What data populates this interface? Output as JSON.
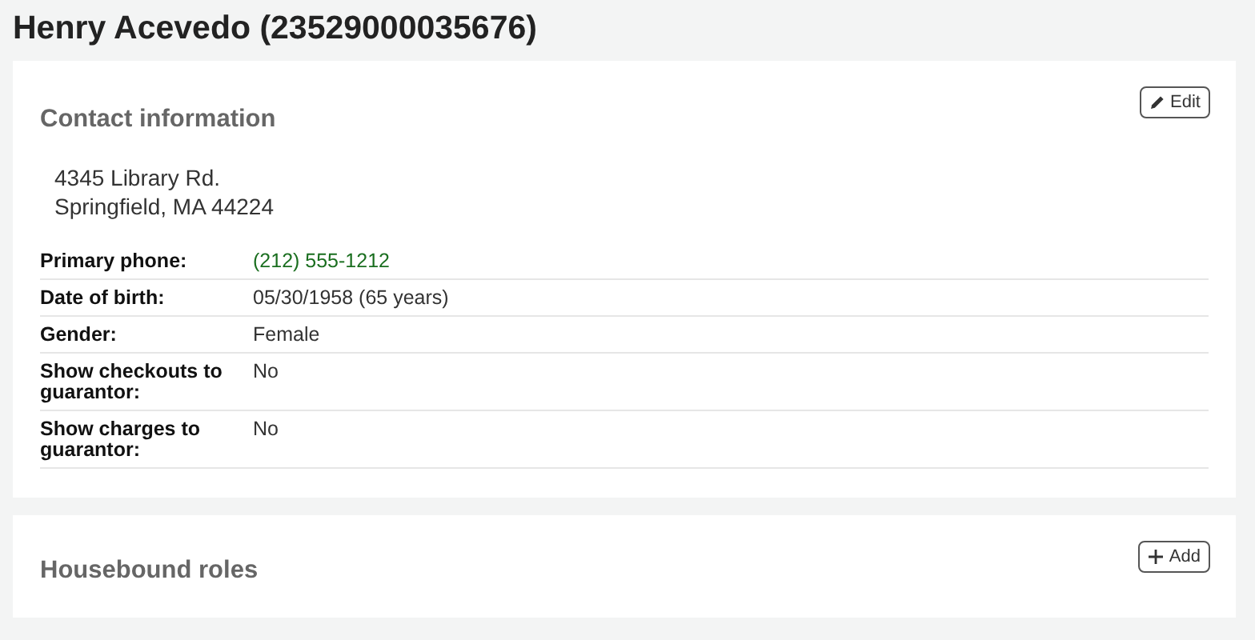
{
  "page_title": "Henry Acevedo (23529000035676)",
  "contact": {
    "heading": "Contact information",
    "edit_button": "Edit",
    "address": [
      "4345 Library Rd.",
      "Springfield, MA 44224"
    ],
    "fields": [
      {
        "label": "Primary phone:",
        "value": "(212) 555-1212",
        "kind": "link"
      },
      {
        "label": "Date of birth:",
        "value": "05/30/1958 (65 years)",
        "kind": "text"
      },
      {
        "label": "Gender:",
        "value": "Female",
        "kind": "text"
      },
      {
        "label": "Show checkouts to guarantor:",
        "value": "No",
        "kind": "text"
      },
      {
        "label": "Show charges to guarantor:",
        "value": "No",
        "kind": "text"
      }
    ]
  },
  "housebound": {
    "heading": "Housebound roles",
    "add_button": "Add"
  }
}
